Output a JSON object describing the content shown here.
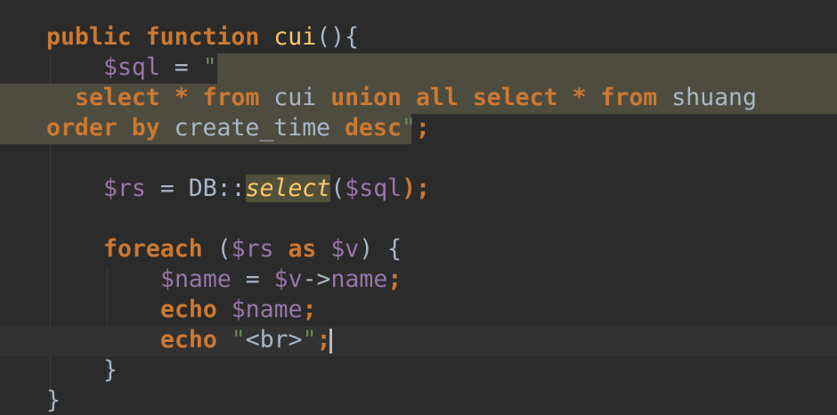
{
  "code": {
    "line1": {
      "kw1": "public",
      "kw2": "function",
      "fn": "cui",
      "rest": "(){"
    },
    "line2": {
      "var": "$sql",
      "eq": " = ",
      "str": "\""
    },
    "line3": {
      "k1": "select",
      "t1": " * ",
      "k2": "from",
      "t2": " cui ",
      "k3": "union",
      "t3": " ",
      "k4": "all",
      "t4": " ",
      "k5": "select",
      "t5": " * ",
      "k6": "from",
      "t6": " shuang"
    },
    "line4": {
      "k1": "order",
      "t1": " ",
      "k2": "by",
      "t2": " create_time ",
      "k3": "desc",
      "str": "\"",
      "semi": ";"
    },
    "line6": {
      "var1": "$rs",
      "eq": " = ",
      "cls": "DB::",
      "method": "select",
      "p1": "(",
      "var2": "$sql",
      "p2": ");"
    },
    "line8": {
      "kw": "foreach",
      "p1": " (",
      "var1": "$rs",
      "sp1": " ",
      "as": "as",
      "sp2": " ",
      "var2": "$v",
      "p2": ") {"
    },
    "line9": {
      "var1": "$name",
      "eq": " = ",
      "var2": "$v",
      "arrow": "->",
      "prop": "name",
      "semi": ";"
    },
    "line10": {
      "kw": "echo",
      "sp": " ",
      "var": "$name",
      "semi": ";"
    },
    "line11": {
      "kw": "echo",
      "sp": " ",
      "q1": "\"",
      "str": "<br>",
      "q2": "\"",
      "semi": ";"
    },
    "line12": {
      "brace": "}"
    },
    "line13": {
      "brace": "}"
    }
  },
  "colors": {
    "background": "#2b2b2b",
    "keyword": "#cc7832",
    "function": "#ffc66d",
    "variable": "#9876aa",
    "string": "#6a8759",
    "plain": "#a9b7c6",
    "selection": "#4e4c3f",
    "current_line": "#323232"
  }
}
